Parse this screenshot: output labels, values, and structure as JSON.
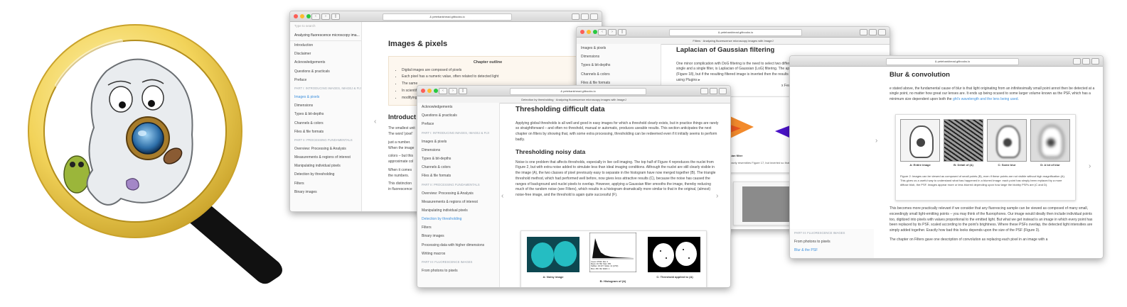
{
  "colors": {
    "accent": "#3c8fdc",
    "lens_ring": "#f2d35a",
    "handle": "#111111"
  },
  "window1": {
    "url": "& petebankhead.gitbooks.io",
    "search_placeholder": "Type to search",
    "book_title": "Analyzing fluorescence microscopy ima...",
    "sidebar": [
      {
        "label": "Introduction"
      },
      {
        "label": "Disclaimer"
      },
      {
        "label": "Acknowledgements"
      },
      {
        "label": "Questions & practicals"
      },
      {
        "label": "Preface"
      },
      {
        "label": "PART I: INTRODUCING IMAGES, IMAGEJ & FIJI",
        "part": true
      },
      {
        "label": "Images & pixels",
        "active": true
      },
      {
        "label": "Dimensions"
      },
      {
        "label": "Types & bit-depths"
      },
      {
        "label": "Channels & colors"
      },
      {
        "label": "Files & file formats"
      },
      {
        "label": "PART II: PROCESSING FUNDAMENTALS",
        "part": true
      },
      {
        "label": "Overview: Processing & Analysis"
      },
      {
        "label": "Measurements & regions of interest"
      },
      {
        "label": "Manipulating individual pixels"
      },
      {
        "label": "Detection by thresholding"
      },
      {
        "label": "Filters"
      },
      {
        "label": "Binary images"
      }
    ],
    "title": "Images & pixels",
    "outline_title": "Chapter outline",
    "outline_items": [
      "Digital images are composed of pixels",
      "Each pixel has a numeric value, often related to detected light",
      "The same",
      "In scientific",
      "modifying"
    ],
    "intro_heading": "Introduct",
    "paragraphs": [
      "The smallest unit",
      "The word 'pixel'",
      "just a number.",
      "When the image",
      "colors – but this",
      "approximate col",
      "When it comes",
      "the numbers.",
      "This distinction",
      "in fluorescence"
    ]
  },
  "window2": {
    "url": "& petebankhead.gitbooks.io",
    "subtitle": "Filters · Analyzing fluorescence microscopy images with ImageJ",
    "sidebar": [
      {
        "label": "Images & pixels"
      },
      {
        "label": "Dimensions"
      },
      {
        "label": "Types & bit-depths"
      },
      {
        "label": "Channels & colors"
      },
      {
        "label": "Files & file formats"
      }
    ],
    "title": "Laplacian of Gaussian filtering",
    "text": "One minor complication with DoG filtering is the need to select two different values of . A similar operation, which requires only a single and a single filter, is Laplacian of Gaussian (LoG) filtering. The appearance of a LoG filter is like an upside-down DoG filter (Figure 18), but if the resulting filtered image is inverted then the results are comparable[1]. You can test out LoG filtering in Fiji using Plugins ▸",
    "text2": "x Feature) Laplacian[2].",
    "caption_a": "aussian filter",
    "caption_b": "B: Inverted version of",
    "caption_line": "G filter. This closely resembles Figure 17, but inverted so that the negative",
    "caption_line2": "ense."
  },
  "window3": {
    "url": "& petebankhead.gitbooks.io",
    "title": "Blur & convolution",
    "para1": "e stated above, the fundamental cause of blur is that light originating from an infinitesimally small point annot then be detected at a single point, no matter how great our lenses are. It ends up being ocused to some larger volume known as the PSF, which has a minimum size dependent upon both the",
    "para1_link": "ght's wavelength and the lens being used.",
    "fig_labels": [
      "A: Entire image",
      "B: Detail of (A)",
      "C: Some blur",
      "D: A lot of blur"
    ],
    "fig_caption": "Figure 2: Images can be viewed as composed of small points (B), even if these points are not visible without high magnification (A). This gives us a useful way to understand what has happened in a blurred image: each point has simply been replaced by a more diffuse blob, the PSF. Images appear more or less blurred depending upon how large the blobby PSFs are (C and D).",
    "para2": "This becomes more practically relevant if we consider that any fluorescing sample can be viewed as composed of many small, exceedingly small light-emitting points – you may think of the fluorophores. Our image would ideally then include individual points too, digitized into pixels with values proportional to the emitted light. But what we get instead is an image in which every point has been replaced by its PSF, scaled according to the point's brightness. Where these PSFs overlap, the detected light intensities are simply added together. Exactly how bad this looks depends upon the size of the PSF (Figure 3).",
    "para3": "The chapter on Filters gave one description of convolution as replacing each pixel in an image with a",
    "sidebar": [
      {
        "label": "PART III: FLUORESCENCE IMAGES",
        "part": true
      },
      {
        "label": "From photons to pixels"
      },
      {
        "label": "Blur & the PSF",
        "active": true
      }
    ]
  },
  "window4": {
    "url": "& petebankhead.gitbooks.io",
    "subtitle": "Detection by thresholding · Analyzing fluorescence microscopy images with ImageJ",
    "sidebar": [
      {
        "label": "Acknowledgements"
      },
      {
        "label": "Questions & practicals"
      },
      {
        "label": "Preface"
      },
      {
        "label": "PART I: INTRODUCING IMAGES, IMAGEJ & FIJI",
        "part": true
      },
      {
        "label": "Images & pixels"
      },
      {
        "label": "Dimensions"
      },
      {
        "label": "Types & bit-depths"
      },
      {
        "label": "Channels & colors"
      },
      {
        "label": "Files & file formats"
      },
      {
        "label": "PART II: PROCESSING FUNDAMENTALS",
        "part": true
      },
      {
        "label": "Overview: Processing & Analysis"
      },
      {
        "label": "Measurements & regions of interest"
      },
      {
        "label": "Manipulating individual pixels"
      },
      {
        "label": "Detection by thresholding",
        "active": true
      },
      {
        "label": "Filters"
      },
      {
        "label": "Binary images"
      },
      {
        "label": "Processing data with higher dimensions"
      },
      {
        "label": "Writing macros"
      },
      {
        "label": "PART III: FLUORESCENCE IMAGES",
        "part": true
      },
      {
        "label": "From photons to pixels"
      }
    ],
    "title": "Thresholding difficult data",
    "para1": "Applying global thresholds is all well and good in easy images for which a threshold clearly exists, but in practice things are rarely so straightforward – and often no threshold, manual or automatic, produces useable results. This section anticipates the next chapter on filters by showing that, with some extra processing, thresholding can be redeemed even if it initially seems to perform badly.",
    "subheading": "Thresholding noisy data",
    "para2": "Noise is one problem that affects thresholds, especially in live cell imaging. The top half of Figure 4 reproduces the nuclei from Figure 2, but with extra noise added to simulate less than ideal imaging conditions. Although the nuclei are still clearly visible in the image (A), the two classes of pixel previously easy to separate in the histogram have now merged together (B). The triangle threshold method, which had performed well before, now gives less attractive results (C), because the noise has caused the ranges of background and nuclei pixels to overlap. However, applying a Gaussian filter smooths the image, thereby reducing much of the random noise (see Filters), which results in a histogram dramatically more similar to that in the original, (almost) noise-free image, and the threshold is again quite successful (F).",
    "fig_labels": [
      "A: Noisy image",
      "B: Histogram of (A)",
      "C: Threshold applied to (A)"
    ],
    "hist_stats": "Count: 67500  Min: 0\nMean: 46.782  Max: 255\nStdDev: 46.337  Mode: 14 (1763)\nBins: 256  Bin Width: 1"
  }
}
